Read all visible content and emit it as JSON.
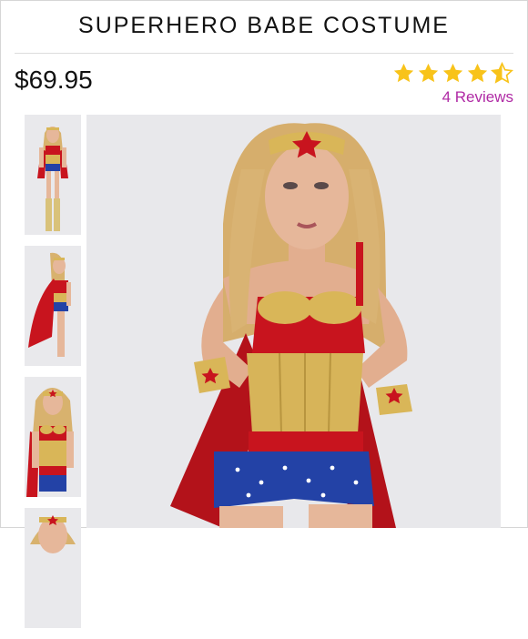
{
  "product": {
    "title": "SUPERHERO BABE COSTUME",
    "price": "$69.95",
    "rating": 4.5,
    "reviews_label": "4 Reviews"
  },
  "colors": {
    "star": "#f8c31a",
    "reviews_link": "#b02aa5",
    "costume_red": "#c8141e",
    "costume_gold": "#d9b658",
    "costume_blue": "#2342a6"
  },
  "gallery": {
    "thumbnails": [
      "front-view",
      "side-view-with-cape",
      "front-close-view",
      "headband-close-view"
    ],
    "main_image": "front-view"
  }
}
